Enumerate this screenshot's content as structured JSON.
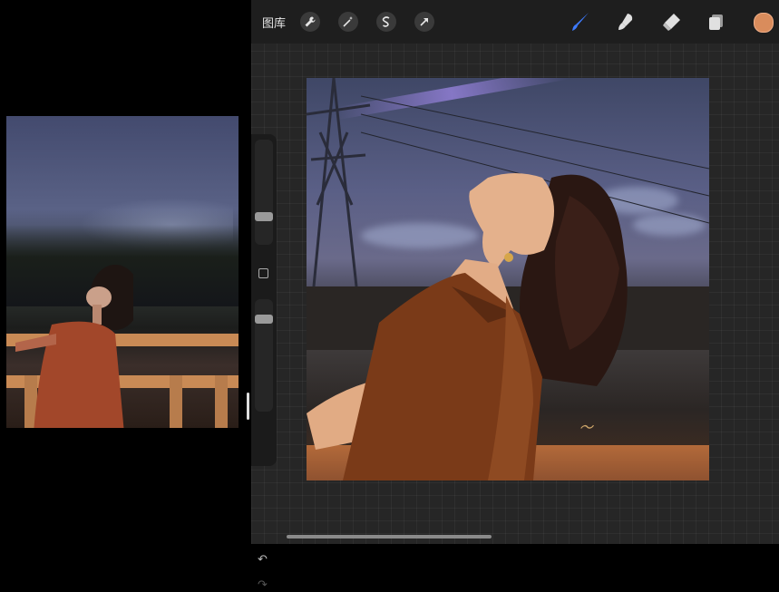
{
  "toolbar": {
    "gallery_label": "图库",
    "left_tools": [
      "wrench-icon",
      "magic-wand-icon",
      "selection-s-icon",
      "arrow-transform-icon"
    ],
    "right_tools": [
      "brush-icon",
      "smudge-icon",
      "eraser-icon",
      "layers-icon"
    ],
    "active_tool": "brush-icon",
    "current_color": "#d98c5c",
    "brush_color": "#3e7bff"
  },
  "sidebar": {
    "brush_size_level": 0.25,
    "opacity_level": 0.85
  },
  "canvas": {
    "signature_text": "～"
  }
}
